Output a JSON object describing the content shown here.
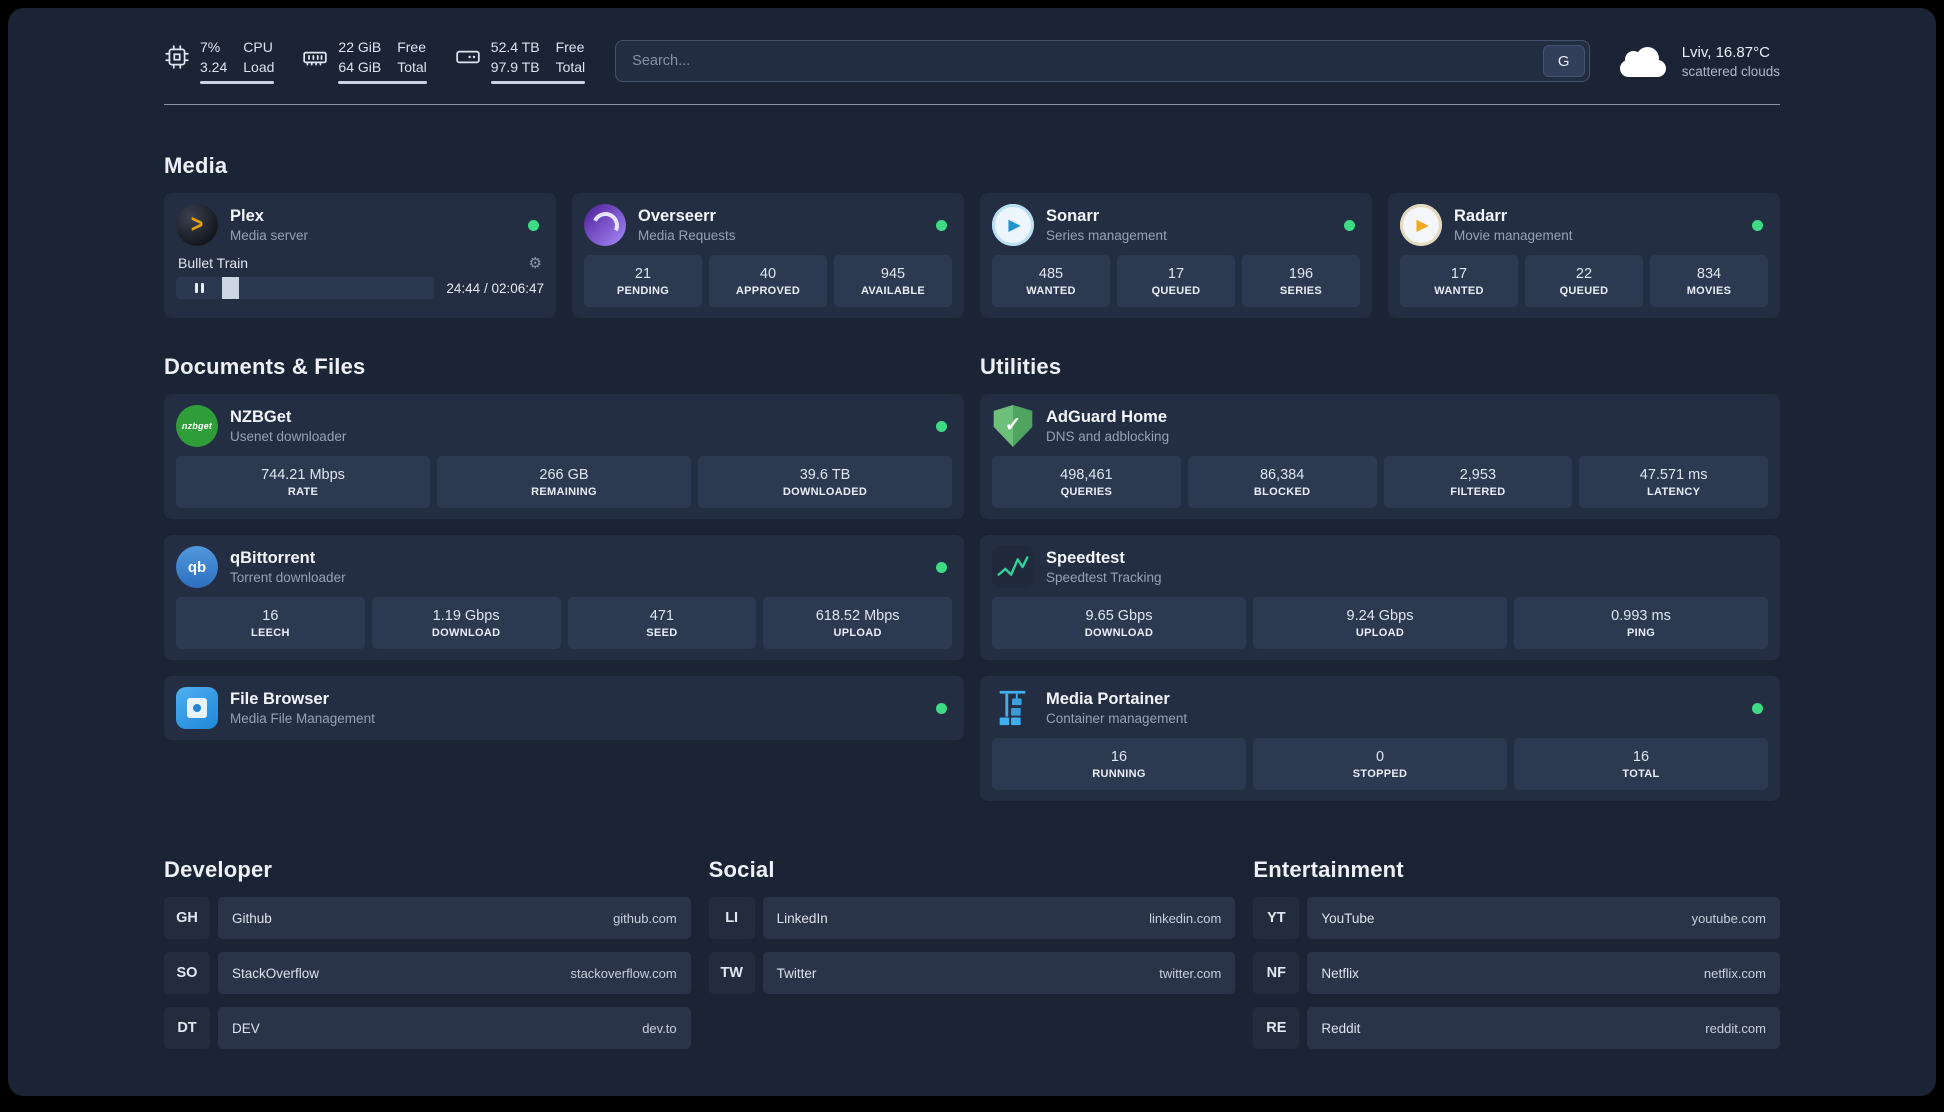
{
  "topbar": {
    "cpu": {
      "percent": "7%",
      "percent_label": "CPU",
      "load": "3.24",
      "load_label": "Load"
    },
    "memory": {
      "free": "22 GiB",
      "free_label": "Free",
      "total": "64 GiB",
      "total_label": "Total"
    },
    "disk": {
      "free": "52.4 TB",
      "free_label": "Free",
      "total": "97.9 TB",
      "total_label": "Total"
    },
    "search": {
      "placeholder": "Search...",
      "provider": "G"
    },
    "weather": {
      "location": "Lviv, 16.87°C",
      "condition": "scattered clouds"
    }
  },
  "sections": {
    "media": {
      "title": "Media",
      "cards": [
        {
          "name": "Plex",
          "desc": "Media server",
          "icon": "plex-icon",
          "status": "online",
          "player": {
            "title": "Bullet Train",
            "time": "24:44 / 02:06:47"
          }
        },
        {
          "name": "Overseerr",
          "desc": "Media Requests",
          "icon": "overseerr-icon",
          "status": "online",
          "stats": [
            {
              "value": "21",
              "label": "PENDING"
            },
            {
              "value": "40",
              "label": "APPROVED"
            },
            {
              "value": "945",
              "label": "AVAILABLE"
            }
          ]
        },
        {
          "name": "Sonarr",
          "desc": "Series management",
          "icon": "sonarr-icon",
          "status": "online",
          "stats": [
            {
              "value": "485",
              "label": "WANTED"
            },
            {
              "value": "17",
              "label": "QUEUED"
            },
            {
              "value": "196",
              "label": "SERIES"
            }
          ]
        },
        {
          "name": "Radarr",
          "desc": "Movie management",
          "icon": "radarr-icon",
          "status": "online",
          "stats": [
            {
              "value": "17",
              "label": "WANTED"
            },
            {
              "value": "22",
              "label": "QUEUED"
            },
            {
              "value": "834",
              "label": "MOVIES"
            }
          ]
        }
      ]
    },
    "documents": {
      "title": "Documents & Files",
      "cards": [
        {
          "name": "NZBGet",
          "desc": "Usenet downloader",
          "icon": "nzbget-icon",
          "status": "online",
          "stats": [
            {
              "value": "744.21 Mbps",
              "label": "RATE"
            },
            {
              "value": "266 GB",
              "label": "REMAINING"
            },
            {
              "value": "39.6 TB",
              "label": "DOWNLOADED"
            }
          ]
        },
        {
          "name": "qBittorrent",
          "desc": "Torrent downloader",
          "icon": "qbittorrent-icon",
          "status": "online",
          "stats": [
            {
              "value": "16",
              "label": "LEECH"
            },
            {
              "value": "1.19 Gbps",
              "label": "DOWNLOAD"
            },
            {
              "value": "471",
              "label": "SEED"
            },
            {
              "value": "618.52 Mbps",
              "label": "UPLOAD"
            }
          ]
        },
        {
          "name": "File Browser",
          "desc": "Media File Management",
          "icon": "filebrowser-icon",
          "status": "online",
          "stats": []
        }
      ]
    },
    "utilities": {
      "title": "Utilities",
      "cards": [
        {
          "name": "AdGuard Home",
          "desc": "DNS and adblocking",
          "icon": "adguard-icon",
          "stats": [
            {
              "value": "498,461",
              "label": "QUERIES"
            },
            {
              "value": "86,384",
              "label": "BLOCKED"
            },
            {
              "value": "2,953",
              "label": "FILTERED"
            },
            {
              "value": "47.571 ms",
              "label": "LATENCY"
            }
          ]
        },
        {
          "name": "Speedtest",
          "desc": "Speedtest Tracking",
          "icon": "speedtest-icon",
          "stats": [
            {
              "value": "9.65 Gbps",
              "label": "DOWNLOAD"
            },
            {
              "value": "9.24 Gbps",
              "label": "UPLOAD"
            },
            {
              "value": "0.993 ms",
              "label": "PING"
            }
          ]
        },
        {
          "name": "Media Portainer",
          "desc": "Container management",
          "icon": "portainer-icon",
          "status": "online",
          "stats": [
            {
              "value": "16",
              "label": "RUNNING"
            },
            {
              "value": "0",
              "label": "STOPPED"
            },
            {
              "value": "16",
              "label": "TOTAL"
            }
          ]
        }
      ]
    }
  },
  "bookmarks": {
    "groups": [
      {
        "title": "Developer",
        "items": [
          {
            "abbr": "GH",
            "name": "Github",
            "url": "github.com"
          },
          {
            "abbr": "SO",
            "name": "StackOverflow",
            "url": "stackoverflow.com"
          },
          {
            "abbr": "DT",
            "name": "DEV",
            "url": "dev.to"
          }
        ]
      },
      {
        "title": "Social",
        "items": [
          {
            "abbr": "LI",
            "name": "LinkedIn",
            "url": "linkedin.com"
          },
          {
            "abbr": "TW",
            "name": "Twitter",
            "url": "twitter.com"
          }
        ]
      },
      {
        "title": "Entertainment",
        "items": [
          {
            "abbr": "YT",
            "name": "YouTube",
            "url": "youtube.com"
          },
          {
            "abbr": "NF",
            "name": "Netflix",
            "url": "netflix.com"
          },
          {
            "abbr": "RE",
            "name": "Reddit",
            "url": "reddit.com"
          }
        ]
      }
    ]
  },
  "colors": {
    "status_online": "#3ddc84",
    "background": "#1b2435",
    "card": "#242e43",
    "tile": "#2d3950"
  }
}
